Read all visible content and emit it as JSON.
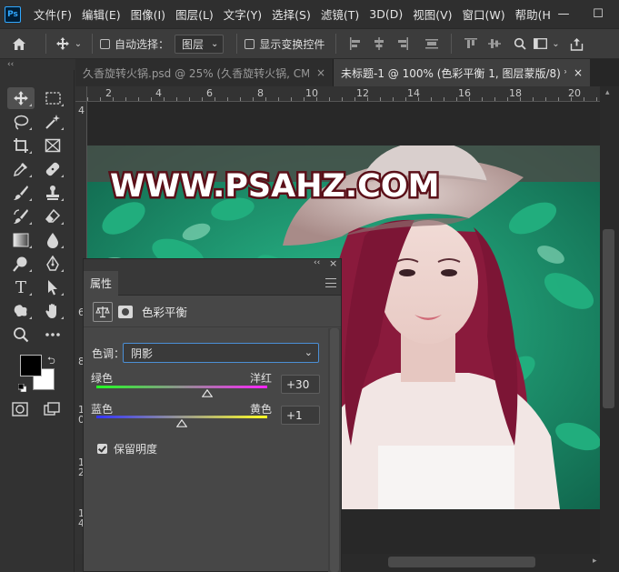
{
  "app": {
    "logo": "Ps"
  },
  "menu": [
    "文件(F)",
    "编辑(E)",
    "图像(I)",
    "图层(L)",
    "文字(Y)",
    "选择(S)",
    "滤镜(T)",
    "3D(D)",
    "视图(V)",
    "窗口(W)",
    "帮助(H"
  ],
  "window_controls": {
    "minimize": "—",
    "maximize": "☐"
  },
  "options": {
    "auto_select_label": "自动选择：",
    "auto_select_value": "图层",
    "show_transform_label": "显示变换控件"
  },
  "tools_collapse": "‹‹",
  "tabs": [
    {
      "label": "久香旋转火锅.psd @ 25% (久香旋转火锅, CM...",
      "close": "×",
      "active": false
    },
    {
      "label": "未标题-1 @ 100% (色彩平衡 1, 图层蒙版/8) *",
      "close": "×",
      "active": true
    }
  ],
  "ruler": {
    "h_labels": [
      "2",
      "4",
      "6",
      "8",
      "10",
      "12",
      "14",
      "16",
      "18",
      "20"
    ],
    "v_labels": [
      "4",
      "6",
      "8",
      "1\n0",
      "1\n2",
      "1\n4"
    ]
  },
  "canvas": {
    "watermark": "WWW.PSAHZ.COM",
    "colors": {
      "foliage": "#1fa37a",
      "hair": "#8a1a3c",
      "hat": "#c9b3b1",
      "skin": "#ecd3cf"
    }
  },
  "properties": {
    "collapse": "‹‹",
    "close": "×",
    "tab": "属性",
    "title": "色彩平衡",
    "tone_label": "色调：",
    "tone_value": "阴影",
    "sliders": [
      {
        "left": "绿色",
        "right": "洋红",
        "value": "+30",
        "level": 0.65
      },
      {
        "left": "蓝色",
        "right": "黄色",
        "value": "+1",
        "level": 0.5
      }
    ],
    "preserve_label": "保留明度",
    "preserve_checked": true
  },
  "colors": {
    "foreground": "#000000",
    "background": "#ffffff",
    "accent": "#4b8fd6"
  }
}
